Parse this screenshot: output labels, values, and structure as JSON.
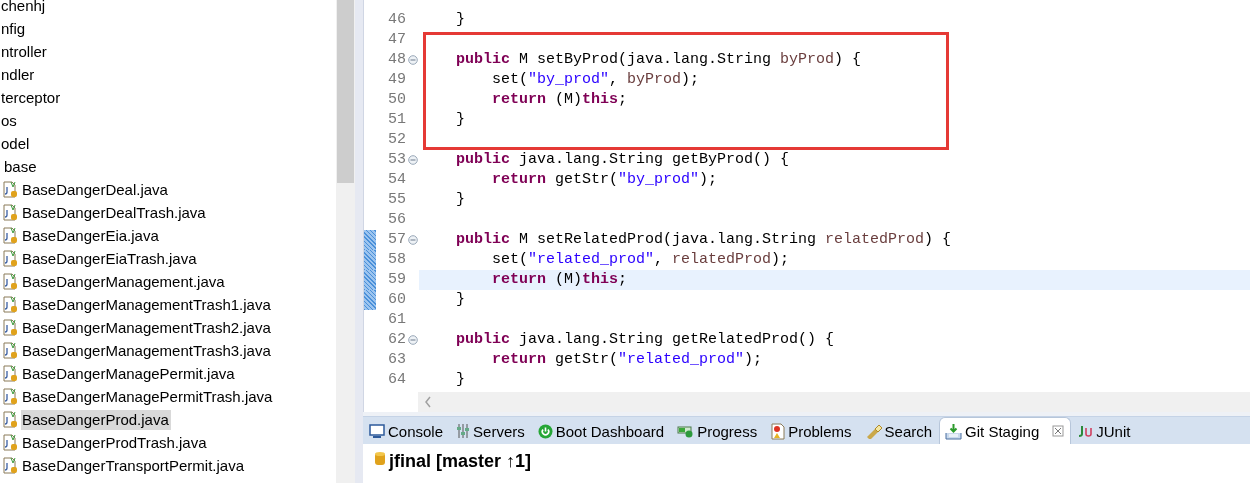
{
  "explorer": {
    "items": [
      {
        "label": "chenhj",
        "selected": false
      },
      {
        "label": "nfig",
        "selected": false
      },
      {
        "label": "ntroller",
        "selected": false
      },
      {
        "label": "ndler",
        "selected": false
      },
      {
        "label": "terceptor",
        "selected": false
      },
      {
        "label": "os",
        "selected": false
      },
      {
        "label": "odel",
        "selected": false,
        "children": [
          {
            "label": "base",
            "selected": false,
            "children": [
              {
                "label": "BaseDangerDeal.java",
                "kind": "java",
                "selected": false
              },
              {
                "label": "BaseDangerDealTrash.java",
                "kind": "java",
                "selected": false
              },
              {
                "label": "BaseDangerEia.java",
                "kind": "java",
                "selected": false
              },
              {
                "label": "BaseDangerEiaTrash.java",
                "kind": "java",
                "selected": false
              },
              {
                "label": "BaseDangerManagement.java",
                "kind": "java",
                "selected": false
              },
              {
                "label": "BaseDangerManagementTrash1.java",
                "kind": "java",
                "selected": false
              },
              {
                "label": "BaseDangerManagementTrash2.java",
                "kind": "java",
                "selected": false
              },
              {
                "label": "BaseDangerManagementTrash3.java",
                "kind": "java",
                "selected": false
              },
              {
                "label": "BaseDangerManagePermit.java",
                "kind": "java",
                "selected": false
              },
              {
                "label": "BaseDangerManagePermitTrash.java",
                "kind": "java",
                "selected": false
              },
              {
                "label": "BaseDangerProd.java",
                "kind": "java",
                "selected": true
              },
              {
                "label": "BaseDangerProdTrash.java",
                "kind": "java",
                "selected": false
              },
              {
                "label": "BaseDangerTransportPermit.java",
                "kind": "java",
                "selected": false
              }
            ]
          }
        ]
      }
    ]
  },
  "editor": {
    "lines": [
      {
        "number": "46",
        "fold": false,
        "changed": false,
        "current": false,
        "framed": false,
        "tokens": [
          {
            "kind": "plain",
            "text": "    }"
          }
        ]
      },
      {
        "number": "47",
        "fold": false,
        "changed": false,
        "current": false,
        "framed": true
      },
      {
        "number": "48",
        "fold": true,
        "changed": false,
        "current": false,
        "framed": true,
        "tokens": [
          {
            "kind": "keyword",
            "text": "    public"
          },
          {
            "kind": "plain",
            "text": " M setByProd(java.lang.String "
          },
          {
            "kind": "param",
            "text": "byProd"
          },
          {
            "kind": "plain",
            "text": ") {"
          }
        ]
      },
      {
        "number": "49",
        "fold": false,
        "changed": false,
        "current": false,
        "framed": true,
        "tokens": [
          {
            "kind": "plain",
            "text": "        set("
          },
          {
            "kind": "string",
            "text": "\"by_prod\""
          },
          {
            "kind": "plain",
            "text": ", "
          },
          {
            "kind": "param",
            "text": "byProd"
          },
          {
            "kind": "plain",
            "text": ");"
          }
        ]
      },
      {
        "number": "50",
        "fold": false,
        "changed": false,
        "current": false,
        "framed": true,
        "tokens": [
          {
            "kind": "keyword",
            "text": "        return"
          },
          {
            "kind": "plain",
            "text": " (M)"
          },
          {
            "kind": "keyword",
            "text": "this"
          },
          {
            "kind": "plain",
            "text": ";"
          }
        ]
      },
      {
        "number": "51",
        "fold": false,
        "changed": false,
        "current": false,
        "framed": true,
        "tokens": [
          {
            "kind": "plain",
            "text": "    }"
          }
        ]
      },
      {
        "number": "52",
        "fold": false,
        "changed": false,
        "current": false,
        "framed": true
      },
      {
        "number": "53",
        "fold": true,
        "changed": false,
        "current": false,
        "framed": false,
        "tokens": [
          {
            "kind": "keyword",
            "text": "    public"
          },
          {
            "kind": "plain",
            "text": " java.lang.String getByProd() {"
          }
        ]
      },
      {
        "number": "54",
        "fold": false,
        "changed": false,
        "current": false,
        "framed": false,
        "tokens": [
          {
            "kind": "keyword",
            "text": "        return"
          },
          {
            "kind": "plain",
            "text": " getStr("
          },
          {
            "kind": "string",
            "text": "\"by_prod\""
          },
          {
            "kind": "plain",
            "text": ");"
          }
        ]
      },
      {
        "number": "55",
        "fold": false,
        "changed": false,
        "current": false,
        "framed": false,
        "tokens": [
          {
            "kind": "plain",
            "text": "    }"
          }
        ]
      },
      {
        "number": "56",
        "fold": false,
        "changed": false,
        "current": false,
        "framed": false
      },
      {
        "number": "57",
        "fold": true,
        "changed": true,
        "current": false,
        "framed": false,
        "tokens": [
          {
            "kind": "keyword",
            "text": "    public"
          },
          {
            "kind": "plain",
            "text": " M setRelatedProd(java.lang.String "
          },
          {
            "kind": "param",
            "text": "relatedProd"
          },
          {
            "kind": "plain",
            "text": ") {"
          }
        ]
      },
      {
        "number": "58",
        "fold": false,
        "changed": true,
        "current": false,
        "framed": false,
        "tokens": [
          {
            "kind": "plain",
            "text": "        set("
          },
          {
            "kind": "string",
            "text": "\"related_prod\""
          },
          {
            "kind": "plain",
            "text": ", "
          },
          {
            "kind": "param",
            "text": "relatedProd"
          },
          {
            "kind": "plain",
            "text": ");"
          }
        ]
      },
      {
        "number": "59",
        "fold": false,
        "changed": true,
        "current": true,
        "framed": false,
        "tokens": [
          {
            "kind": "keyword",
            "text": "        return"
          },
          {
            "kind": "plain",
            "text": " (M)"
          },
          {
            "kind": "keyword",
            "text": "this"
          },
          {
            "kind": "plain",
            "text": ";"
          }
        ]
      },
      {
        "number": "60",
        "fold": false,
        "changed": true,
        "current": false,
        "framed": false,
        "tokens": [
          {
            "kind": "plain",
            "text": "    }"
          }
        ]
      },
      {
        "number": "61",
        "fold": false,
        "changed": false,
        "current": false,
        "framed": false
      },
      {
        "number": "62",
        "fold": true,
        "changed": false,
        "current": false,
        "framed": false,
        "tokens": [
          {
            "kind": "keyword",
            "text": "    public"
          },
          {
            "kind": "plain",
            "text": " java.lang.String getRelatedProd() {"
          }
        ]
      },
      {
        "number": "63",
        "fold": false,
        "changed": false,
        "current": false,
        "framed": false,
        "tokens": [
          {
            "kind": "keyword",
            "text": "        return"
          },
          {
            "kind": "plain",
            "text": " getStr("
          },
          {
            "kind": "string",
            "text": "\"related_prod\""
          },
          {
            "kind": "plain",
            "text": ");"
          }
        ]
      },
      {
        "number": "64",
        "fold": false,
        "changed": false,
        "current": false,
        "framed": false,
        "tokens": [
          {
            "kind": "plain",
            "text": "    }"
          }
        ]
      }
    ]
  },
  "bottom_panel": {
    "tabs": [
      {
        "label": "Console",
        "kind": "console",
        "selected": false
      },
      {
        "label": "Servers",
        "kind": "servers",
        "selected": false
      },
      {
        "label": "Boot Dashboard",
        "kind": "boot",
        "selected": false
      },
      {
        "label": "Progress",
        "kind": "progress",
        "selected": false
      },
      {
        "label": "Problems",
        "kind": "problems",
        "selected": false
      },
      {
        "label": "Search",
        "kind": "search",
        "selected": false
      },
      {
        "label": "Git Staging",
        "kind": "git",
        "selected": true
      },
      {
        "label": "JUnit",
        "kind": "junit",
        "selected": false
      }
    ],
    "repository": "jfinal [master ↑1]"
  }
}
